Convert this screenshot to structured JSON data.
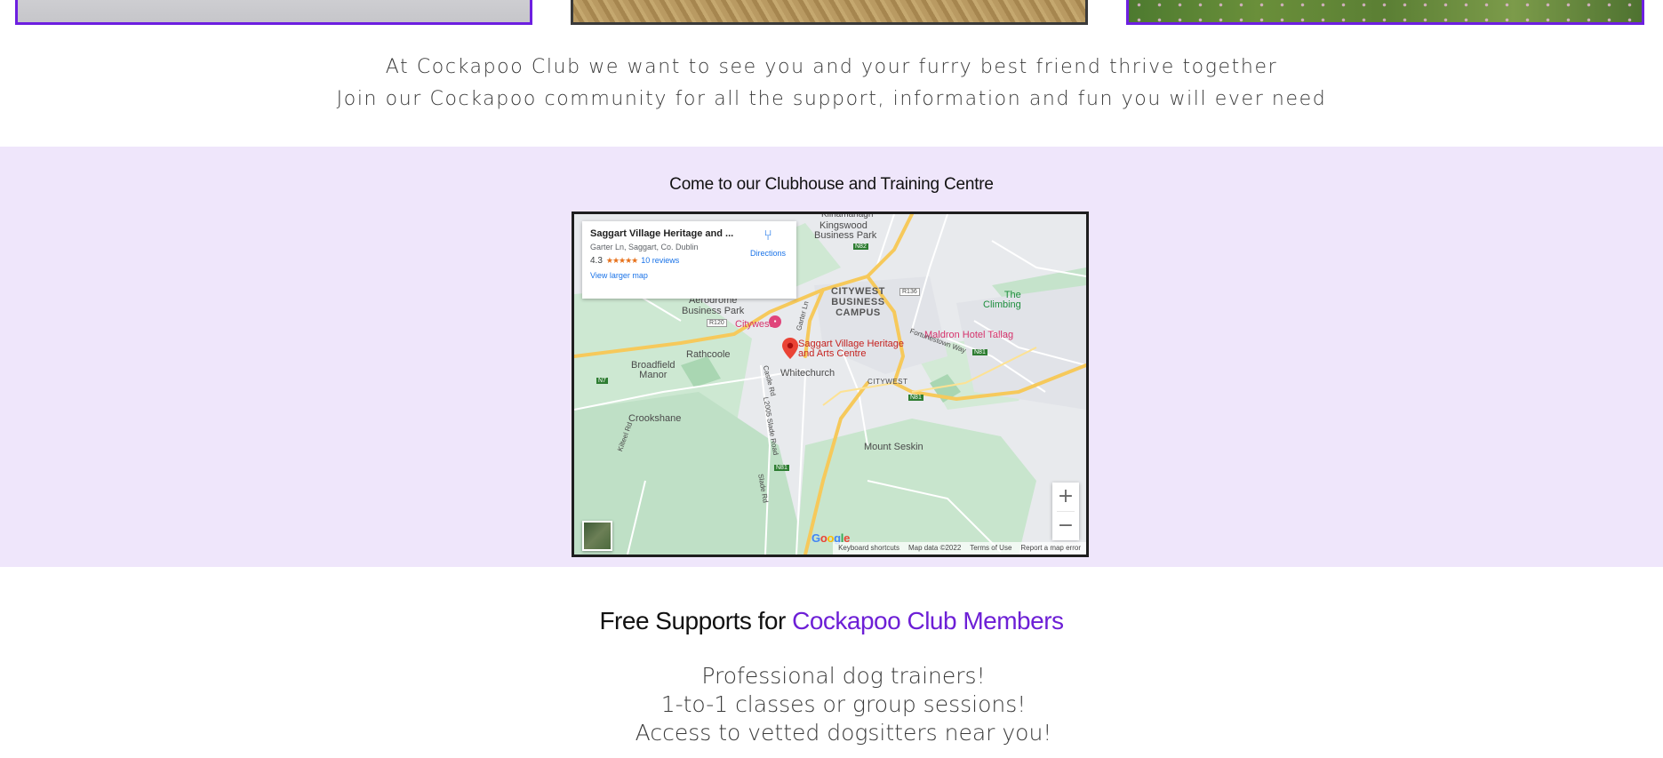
{
  "intro": {
    "line1": "At Cockapoo Club we want to see you and your furry best friend thrive together",
    "line2": "Join our Cockapoo community for all the support, information and fun you will ever need"
  },
  "clubhouse": {
    "title": "Come to our Clubhouse and Training Centre"
  },
  "map": {
    "card": {
      "title": "Saggart Village Heritage and ...",
      "address": "Garter Ln, Saggart, Co. Dublin",
      "rating": "4.3",
      "stars": "★★★★★",
      "reviews": "10 reviews",
      "larger_map": "View larger map",
      "directions": "Directions"
    },
    "labels": {
      "kilnamanagh": "Kilnamanagh",
      "kingswood": "Kingswood",
      "business_park": "Business Park",
      "citywest_campus_1": "CITYWEST",
      "citywest_campus_2": "BUSINESS",
      "citywest_campus_3": "CAMPUS",
      "aerodrome_1": "Aerodrome",
      "aerodrome_2": "Business Park",
      "citywest_poi": "Citywest",
      "pin_1": "Saggart Village Heritage",
      "pin_2": "and Arts Centre",
      "rathcoole": "Rathcoole",
      "broadfield_1": "Broadfield",
      "broadfield_2": "Manor",
      "whitechurch": "Whitechurch",
      "crookshane": "Crookshane",
      "mount_seskin": "Mount Seskin",
      "maldron": "Maldron Hotel Tallag",
      "climbing_1": "The",
      "climbing_2": "Climbing",
      "fortunestown": "Fortunestown Way",
      "citywest_road": "CITYWEST",
      "r120": "R120",
      "r136": "R136",
      "n7": "N7",
      "n81a": "N81",
      "n81b": "N81",
      "n81c": "N81",
      "n82": "N82",
      "kilteel": "Kilteel Rd",
      "castle": "Castle Rd",
      "slade": "L2005 Slade Road",
      "garter": "Garter Ln",
      "slade2": "Slade Rd"
    },
    "google": "Google",
    "attribution": {
      "shortcuts": "Keyboard shortcuts",
      "data": "Map data ©2022",
      "terms": "Terms of Use",
      "report": "Report a map error"
    },
    "zoom_in": "+",
    "zoom_out": "−",
    "icons": {
      "directions": "directions-icon",
      "pin": "map-pin-icon",
      "citywest": "hotel-icon"
    }
  },
  "supports": {
    "title_plain": "Free Supports for ",
    "title_accent": "Cockapoo Club Members",
    "items": [
      "Professional dog trainers!",
      "1-to-1 classes or group sessions!",
      "Access to vetted dogsitters near you!"
    ]
  },
  "colors": {
    "accent": "#6d1fd6",
    "band_background": "#efe6fb",
    "frame": "#6d1fe0"
  }
}
